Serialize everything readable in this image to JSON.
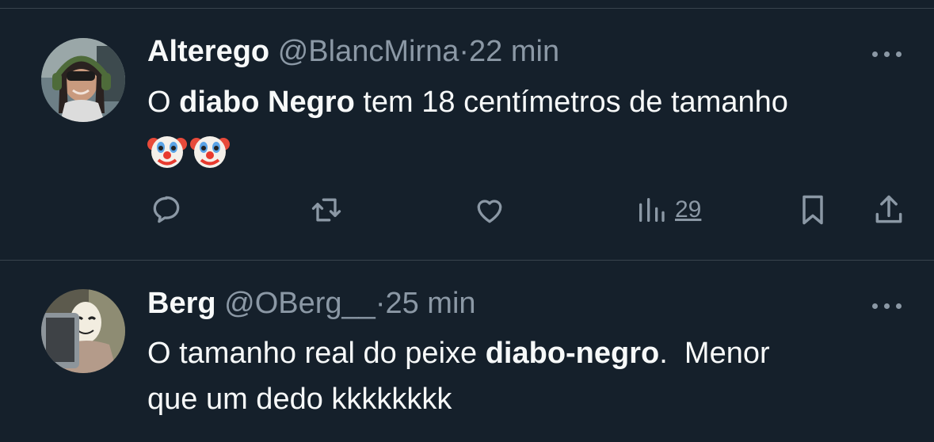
{
  "tweets": [
    {
      "name": "Alterego",
      "handle": "@BlancMirna",
      "dot": "·",
      "time": "22 min",
      "text_parts": [
        "O ",
        "diabo Negro",
        " tem 18 centímetros de tamanho"
      ],
      "emoji": [
        "clown-face",
        "clown-face"
      ],
      "views": "29"
    },
    {
      "name": "Berg",
      "handle": "@OBerg__",
      "dot": "·",
      "time": "25 min",
      "text_parts": [
        "O tamanho real do peixe ",
        "diabo-negro",
        ".  Menor",
        "que um dedo kkkkkkkk"
      ]
    }
  ],
  "colors": {
    "background": "#15202b",
    "secondary_text": "#8b98a5",
    "divider": "#38444d"
  },
  "icons": [
    "reply-icon",
    "retweet-icon",
    "like-icon",
    "views-icon",
    "bookmark-icon",
    "share-icon",
    "more-icon"
  ]
}
